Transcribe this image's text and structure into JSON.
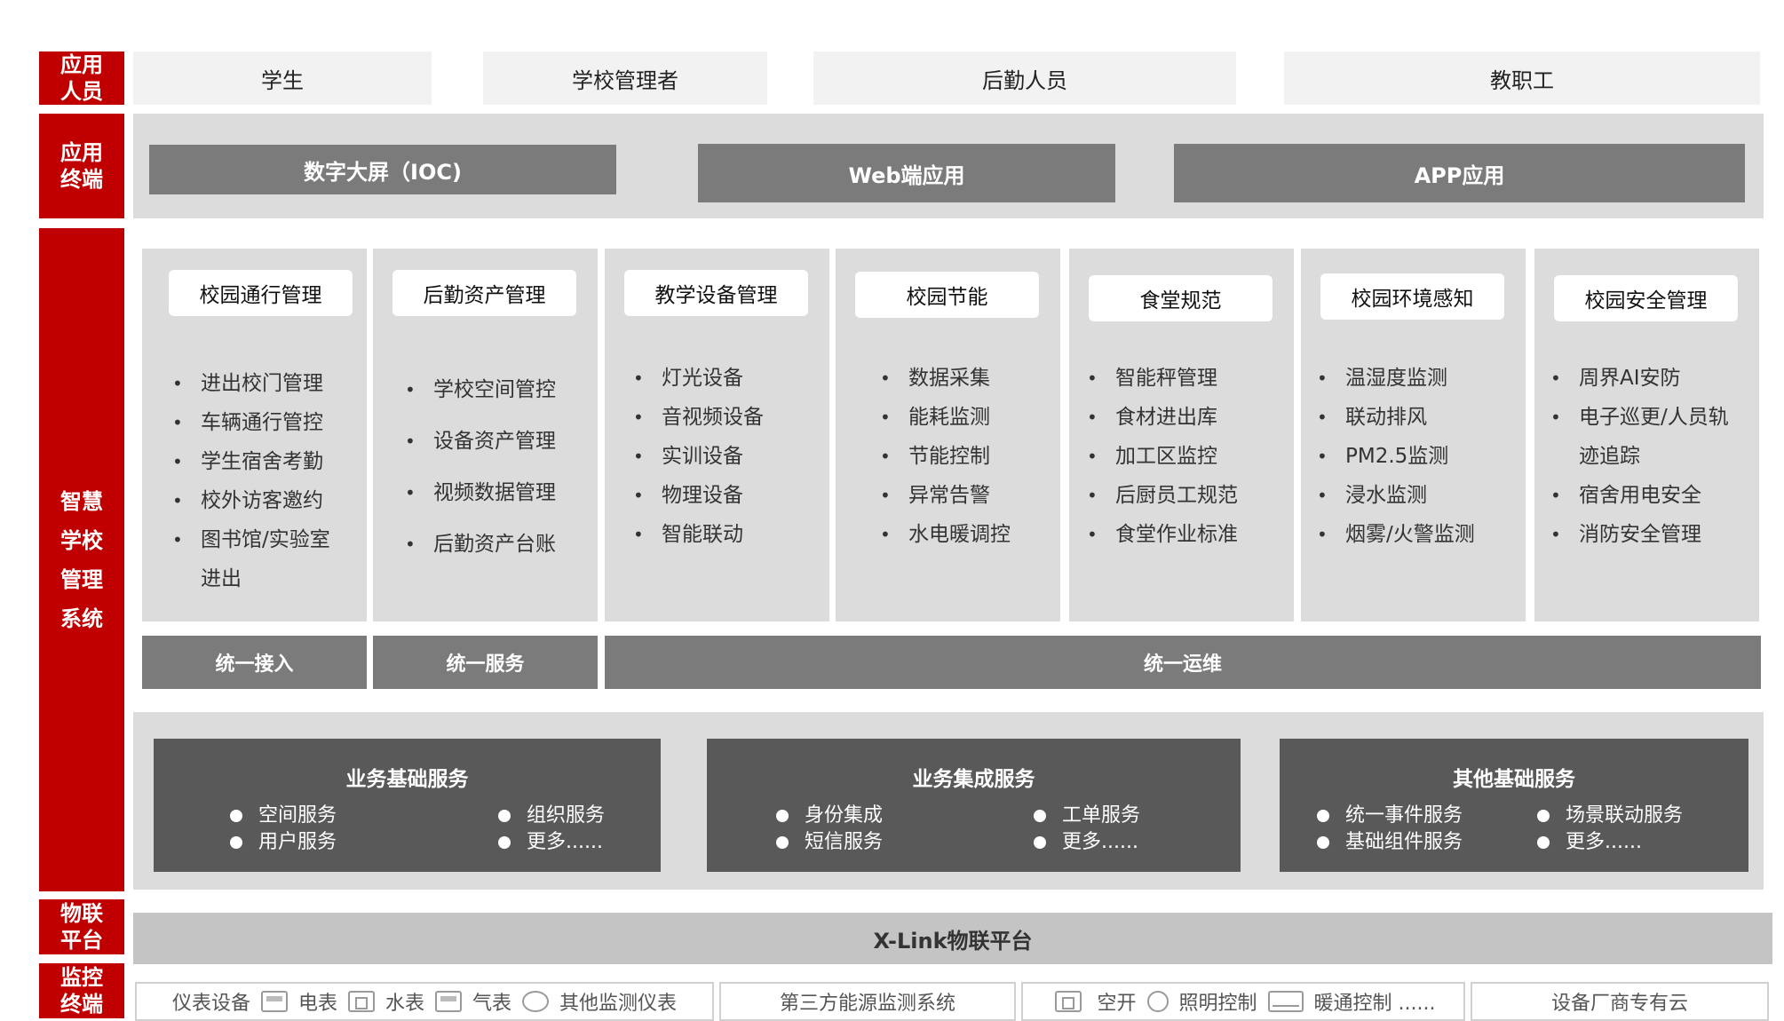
{
  "layers": {
    "users": "应用人员",
    "terminals": "应用终端",
    "system": "智慧学校管理系统",
    "iot": "物联平台",
    "monitor": "监控终端"
  },
  "users": [
    "学生",
    "学校管理者",
    "后勤人员",
    "教职工"
  ],
  "terminals": [
    "数字大屏（IOC)",
    "Web端应用",
    "APP应用"
  ],
  "modules": [
    {
      "title": "校园通行管理",
      "items": [
        "进出校门管理",
        "车辆通行管控",
        "学生宿舍考勤",
        "校外访客邀约",
        "图书馆/实验室进出"
      ]
    },
    {
      "title": "后勤资产管理",
      "items": [
        "学校空间管控",
        "设备资产管理",
        "视频数据管理",
        "后勤资产台账"
      ]
    },
    {
      "title": "教学设备管理",
      "items": [
        "灯光设备",
        "音视频设备",
        "实训设备",
        "物理设备",
        "智能联动"
      ]
    },
    {
      "title": "校园节能",
      "items": [
        "数据采集",
        "能耗监测",
        "节能控制",
        "异常告警",
        "水电暖调控"
      ]
    },
    {
      "title": "食堂规范",
      "items": [
        "智能秤管理",
        "食材进出库",
        "加工区监控",
        "后厨员工规范",
        "食堂作业标准"
      ]
    },
    {
      "title": "校园环境感知",
      "items": [
        "温湿度监测",
        "联动排风",
        "PM2.5监测",
        "浸水监测",
        "烟雾/火警监测"
      ]
    },
    {
      "title": "校园安全管理",
      "items": [
        "周界AI安防",
        "电子巡更/人员轨迹追踪",
        "宿舍用电安全",
        "消防安全管理"
      ]
    }
  ],
  "unified": [
    "统一接入",
    "统一服务",
    "统一运维"
  ],
  "services": [
    {
      "title": "业务基础服务",
      "items": [
        "空间服务",
        "组织服务",
        "用户服务",
        "更多......"
      ]
    },
    {
      "title": "业务集成服务",
      "items": [
        "身份集成",
        "工单服务",
        "短信服务",
        "更多......"
      ]
    },
    {
      "title": "其他基础服务",
      "items": [
        "统一事件服务",
        "场景联动服务",
        "基础组件服务",
        "更多......"
      ]
    }
  ],
  "platform": "X-Link物联平台",
  "monitor": {
    "group1": [
      "仪表设备",
      "电表",
      "水表",
      "气表",
      "其他监测仪表"
    ],
    "group2": "第三方能源监测系统",
    "group3": [
      "空开",
      "照明控制",
      "暖通控制 ......"
    ],
    "group4": "设备厂商专有云"
  },
  "icons": [
    "meter-icon",
    "water-meter-icon",
    "gas-meter-icon",
    "other-meter-icon",
    "breaker-icon",
    "lighting-icon",
    "hvac-icon"
  ],
  "colors": {
    "accent": "#c00000",
    "dark_bar": "#7b7b7b",
    "service_box": "#595959",
    "panel": "#dcdcdc"
  }
}
